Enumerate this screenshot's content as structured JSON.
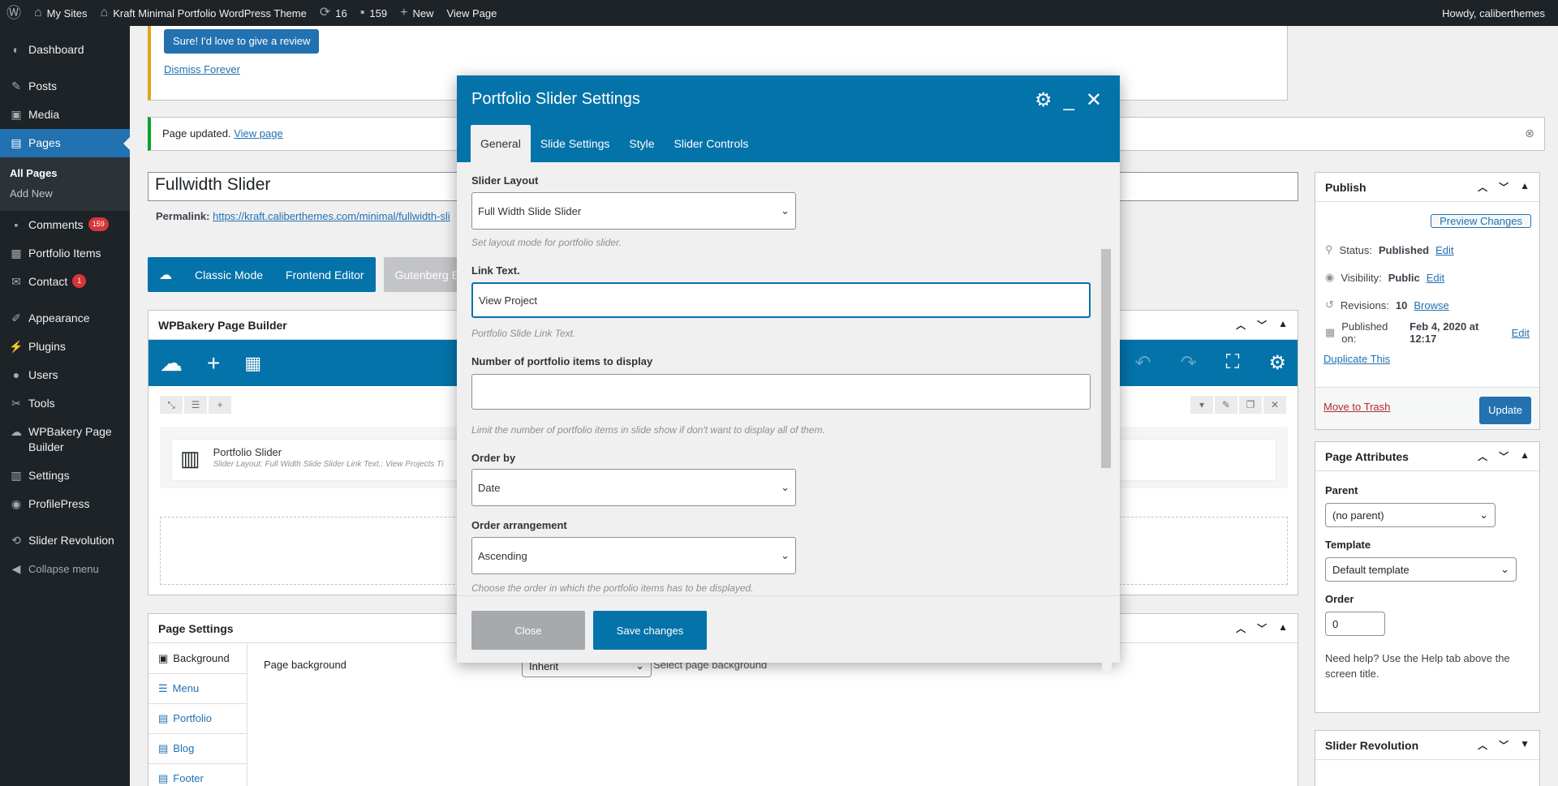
{
  "adminbar": {
    "my_sites": "My Sites",
    "site_name": "Kraft Minimal Portfolio WordPress Theme",
    "updates": "16",
    "comments": "159",
    "new": "New",
    "view_page": "View Page",
    "howdy": "Howdy, caliberthemes"
  },
  "sidebar": {
    "dashboard": "Dashboard",
    "posts": "Posts",
    "media": "Media",
    "pages": "Pages",
    "all_pages": "All Pages",
    "add_new": "Add New",
    "comments": "Comments",
    "comments_badge": "159",
    "portfolio_items": "Portfolio Items",
    "contact": "Contact",
    "contact_badge": "1",
    "appearance": "Appearance",
    "plugins": "Plugins",
    "users": "Users",
    "tools": "Tools",
    "wpbakery": "WPBakery Page Builder",
    "settings": "Settings",
    "profilepress": "ProfilePress",
    "slider_revolution": "Slider Revolution",
    "collapse": "Collapse menu"
  },
  "notices": {
    "review_button": "Sure! I'd love to give a review",
    "dismiss_forever": "Dismiss Forever",
    "page_updated": "Page updated.",
    "view_page": "View page"
  },
  "editor": {
    "title": "Fullwidth Slider",
    "permalink_label": "Permalink:",
    "permalink_url": "https://kraft.caliberthemes.com/minimal/fullwidth-sli",
    "classic_mode": "Classic Mode",
    "frontend_editor": "Frontend Editor",
    "gutenberg_editor": "Gutenberg Editor"
  },
  "wpbakery": {
    "heading": "WPBakery Page Builder",
    "element_title": "Portfolio Slider",
    "element_desc": "Slider Layout: Full Width Slide Slider  Link Text.: View Projects  Ti"
  },
  "page_settings": {
    "heading": "Page Settings",
    "nav": [
      "Background",
      "Menu",
      "Portfolio",
      "Blog",
      "Footer"
    ],
    "bg_label": "Page background",
    "bg_value": "Inherit",
    "bg_help": "Select page background"
  },
  "publish": {
    "heading": "Publish",
    "preview": "Preview Changes",
    "status_label": "Status:",
    "status_value": "Published",
    "visibility_label": "Visibility:",
    "visibility_value": "Public",
    "revisions_label": "Revisions:",
    "revisions_value": "10",
    "browse": "Browse",
    "published_on_label": "Published on:",
    "published_on_value": "Feb 4, 2020 at 12:17",
    "edit": "Edit",
    "duplicate": "Duplicate This",
    "trash": "Move to Trash",
    "update": "Update"
  },
  "attributes": {
    "heading": "Page Attributes",
    "parent_label": "Parent",
    "parent_value": "(no parent)",
    "template_label": "Template",
    "template_value": "Default template",
    "order_label": "Order",
    "order_value": "0",
    "help": "Need help? Use the Help tab above the screen title."
  },
  "slider_rev_box": {
    "heading": "Slider Revolution"
  },
  "modal": {
    "title": "Portfolio Slider Settings",
    "tabs": [
      "General",
      "Slide Settings",
      "Style",
      "Slider Controls"
    ],
    "slider_layout_label": "Slider Layout",
    "slider_layout_value": "Full Width Slide Slider",
    "slider_layout_help": "Set layout mode for portfolio slider.",
    "link_text_label": "Link Text.",
    "link_text_value": "View Project",
    "link_text_help": "Portfolio Slide Link Text.",
    "count_label": "Number of portfolio items to display",
    "count_value": "",
    "count_help": "Limit the number of portfolio items in slide show if don't want to display all of them.",
    "orderby_label": "Order by",
    "orderby_value": "Date",
    "order_label": "Order arrangement",
    "order_value": "Ascending",
    "order_help": "Choose the order in which the portfolio items has to be displayed.",
    "close": "Close",
    "save": "Save changes"
  },
  "colors": {
    "wp_blue": "#2271b1",
    "wpb_blue": "#0473aa",
    "adminbar": "#1d2327",
    "warning": "#dba617",
    "success": "#00a32a",
    "badge": "#d63638"
  }
}
